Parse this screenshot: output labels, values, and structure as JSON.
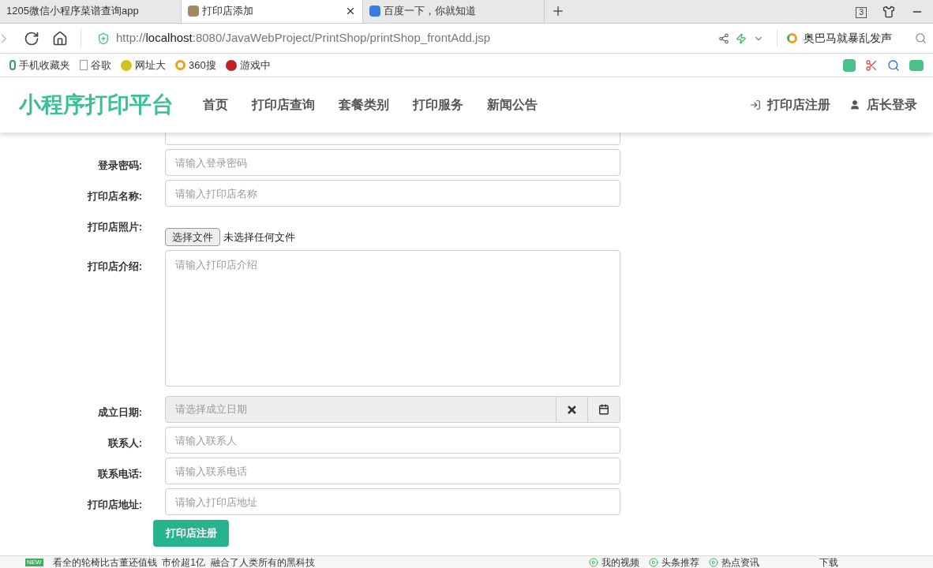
{
  "browser": {
    "tabs": [
      {
        "title": "1205微信小程序菜谱查询app",
        "selected": false
      },
      {
        "title": "打印店添加",
        "selected": true
      },
      {
        "title": "百度一下，你就知道",
        "selected": false
      }
    ],
    "tab_count": "3",
    "url_prefix": "http://",
    "url_host": "localhost",
    "url_rest": ":8080/JavaWebProject/PrintShop/printShop_frontAdd.jsp",
    "search_suggestion": "奥巴马就暴乱发声",
    "bookmarks": [
      "手机收藏夹",
      "谷歌",
      "网址大",
      "360搜",
      "游戏中"
    ]
  },
  "navbar": {
    "brand": "小程序打印平台",
    "links": [
      "首页",
      "打印店查询",
      "套餐类别",
      "打印服务",
      "新闻公告"
    ],
    "register": "打印店注册",
    "login": "店长登录"
  },
  "form": {
    "fields": [
      {
        "kind": "text"
      },
      {
        "kind": "text",
        "label": "登录密码:",
        "placeholder": "请输入登录密码"
      },
      {
        "kind": "text",
        "label": "打印店名称:",
        "placeholder": "请输入打印店名称"
      },
      {
        "kind": "file",
        "label": "打印店照片:",
        "button": "选择文件",
        "status": "未选择任何文件"
      },
      {
        "kind": "textarea",
        "label": "打印店介绍:",
        "placeholder": "请输入打印店介绍"
      },
      {
        "kind": "date",
        "label": "成立日期:",
        "placeholder": "请选择成立日期"
      },
      {
        "kind": "text",
        "label": "联系人:",
        "placeholder": "请输入联系人"
      },
      {
        "kind": "text",
        "label": "联系电话:",
        "placeholder": "请输入联系电话"
      },
      {
        "kind": "text",
        "label": "打印店地址:",
        "placeholder": "请输入打印店地址"
      }
    ],
    "submit": "打印店注册"
  },
  "status_bar": {
    "badge": "NEW",
    "news": "看全的轮椅比古董还值钱  市价超1亿  融合了人类所有的黑科技",
    "items": [
      "我的视频",
      "头条推荐",
      "热点资讯"
    ],
    "download": "下载"
  }
}
